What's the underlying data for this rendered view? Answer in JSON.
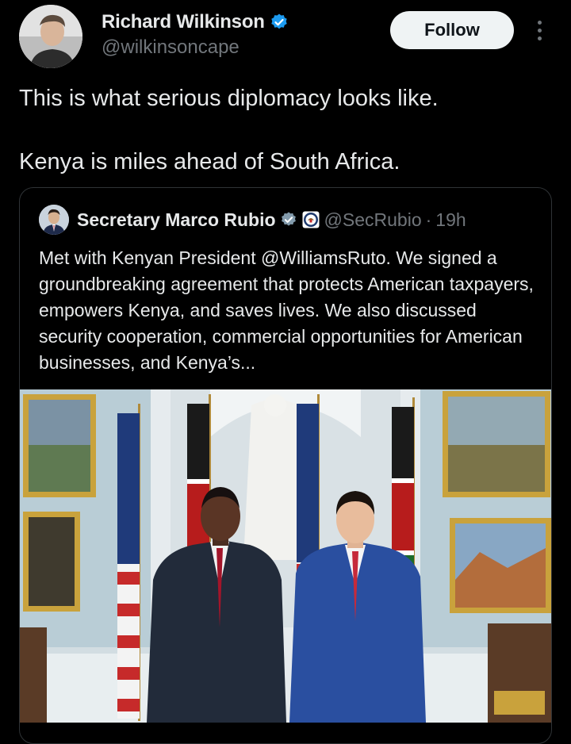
{
  "author": {
    "display_name": "Richard Wilkinson",
    "handle": "@wilkinsoncape",
    "verified": true
  },
  "actions": {
    "follow_label": "Follow",
    "more_icon": "more-dots-icon"
  },
  "tweet": {
    "line1": "This is what serious diplomacy looks like.",
    "line2": "Kenya is miles ahead of South Africa."
  },
  "quoted": {
    "display_name": "Secretary Marco Rubio",
    "verified": true,
    "affiliation_icon": "state-department-seal-icon",
    "handle": "@SecRubio",
    "separator": "·",
    "time": "19h",
    "text": "Met with Kenyan President @WilliamsRuto. We signed a groundbreaking agreement that protects American taxpayers, empowers Kenya, and saves lives. We also discussed security cooperation, commercial opportunities for American businesses, and Kenya’s..."
  },
  "colors": {
    "background": "#000000",
    "primary_text": "#e7e9ea",
    "secondary_text": "#71767b",
    "verified_blue": "#1d9bf0",
    "border": "#2f3336",
    "follow_bg": "#eff3f4"
  }
}
